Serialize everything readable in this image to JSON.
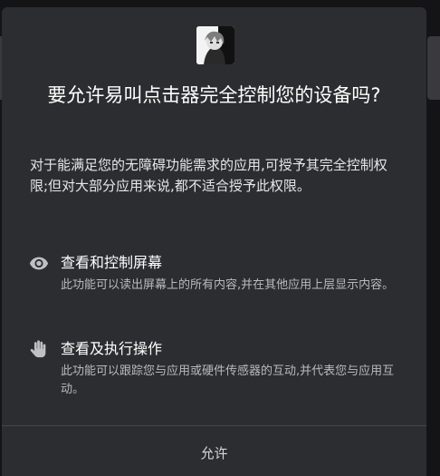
{
  "dialog": {
    "title": "要允许易叫点击器完全控制您的设备吗?",
    "description": "对于能满足您的无障碍功能需求的应用,可授予其完全控制权限;但对大部分应用来说,都不适合授予此权限。",
    "permissions": [
      {
        "icon": "eye-icon",
        "title": "查看和控制屏幕",
        "description": "此功能可以读出屏幕上的所有内容,并在其他应用上层显示内容。"
      },
      {
        "icon": "hand-icon",
        "title": "查看及执行操作",
        "description": "此功能可以跟踪您与应用或硬件传感器的互动,并代表您与应用互动。"
      }
    ],
    "allow_label": "允许"
  },
  "colors": {
    "dialog_bg": "#2c2d30",
    "screen_bg": "#141416",
    "title_text": "#ffffff",
    "secondary_text": "#b9babd",
    "divider": "#45464a"
  }
}
